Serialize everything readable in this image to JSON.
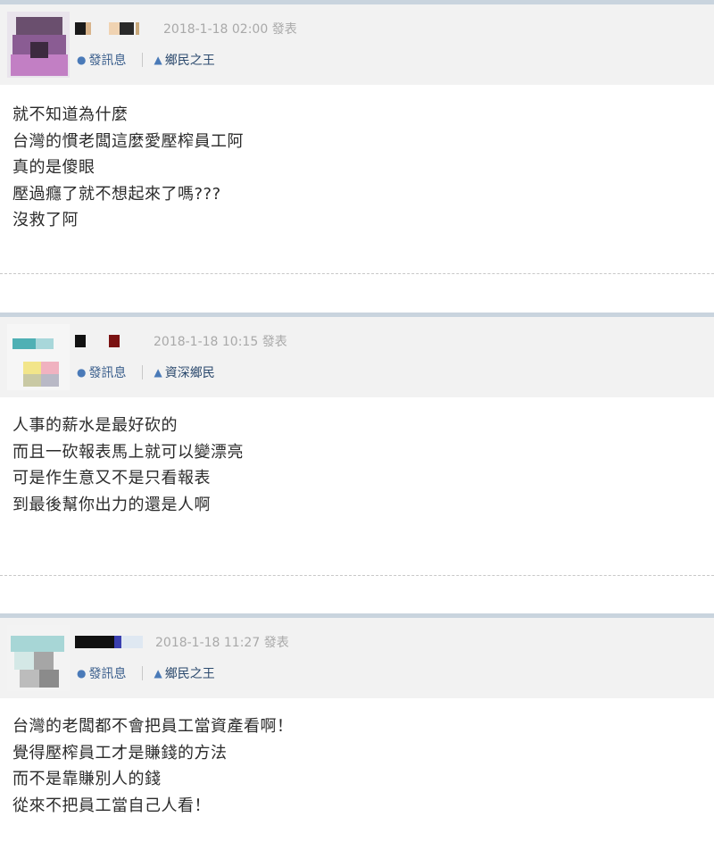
{
  "posts": [
    {
      "timestamp": "2018-1-18 02:00 發表",
      "message_link": "發訊息",
      "rank": "鄉民之王",
      "lines": [
        "就不知道為什麼",
        "台灣的慣老闆這麼愛壓榨員工阿",
        "真的是傻眼",
        "壓過癮了就不想起來了嗎???",
        "沒救了阿"
      ]
    },
    {
      "timestamp": "2018-1-18 10:15 發表",
      "message_link": "發訊息",
      "rank": "資深鄉民",
      "lines": [
        "人事的薪水是最好砍的",
        "而且一砍報表馬上就可以變漂亮",
        "可是作生意又不是只看報表",
        "到最後幫你出力的還是人啊"
      ]
    },
    {
      "timestamp": "2018-1-18 11:27 發表",
      "message_link": "發訊息",
      "rank": "鄉民之王",
      "lines": [
        "台灣的老闆都不會把員工當資產看啊！",
        "覺得壓榨員工才是賺錢的方法",
        "而不是靠賺別人的錢",
        "從來不把員工當自己人看！"
      ]
    }
  ],
  "icons": {
    "message": "chat-bubble-icon",
    "rank": "user-icon"
  },
  "colors": {
    "header_bg": "#f2f2f2",
    "separator_bar": "#c9d4de",
    "link": "#3a5e8c",
    "timestamp": "#a9a9a9"
  }
}
